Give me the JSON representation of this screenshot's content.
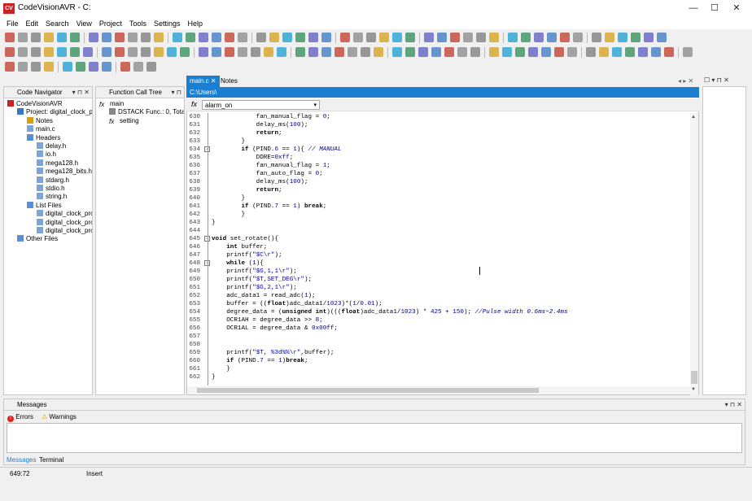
{
  "window": {
    "title": "CodeVisionAVR - C:",
    "logo": "CV"
  },
  "menu": [
    "File",
    "Edit",
    "Search",
    "View",
    "Project",
    "Tools",
    "Settings",
    "Help"
  ],
  "panels": {
    "code_navigator": "Code Navigator",
    "function_call_tree": "Function Call Tree",
    "messages": "Messages"
  },
  "nav_tree": [
    {
      "label": "CodeVisionAVR",
      "indent": 0,
      "icon": "cv-logo-icon"
    },
    {
      "label": "Project: digital_clock_pro",
      "indent": 1,
      "icon": "project-icon"
    },
    {
      "label": "Notes",
      "indent": 2,
      "icon": "notes-icon"
    },
    {
      "label": "main.c",
      "indent": 2,
      "icon": "file-icon"
    },
    {
      "label": "Headers",
      "indent": 2,
      "icon": "folder-icon"
    },
    {
      "label": "delay.h",
      "indent": 3,
      "icon": "file-icon"
    },
    {
      "label": "io.h",
      "indent": 3,
      "icon": "file-icon"
    },
    {
      "label": "mega128.h",
      "indent": 3,
      "icon": "file-icon"
    },
    {
      "label": "mega128_bits.h",
      "indent": 3,
      "icon": "file-icon"
    },
    {
      "label": "stdarg.h",
      "indent": 3,
      "icon": "file-icon"
    },
    {
      "label": "stdio.h",
      "indent": 3,
      "icon": "file-icon"
    },
    {
      "label": "string.h",
      "indent": 3,
      "icon": "file-icon"
    },
    {
      "label": "List Files",
      "indent": 2,
      "icon": "folder-icon"
    },
    {
      "label": "digital_clock_pro",
      "indent": 3,
      "icon": "file-icon"
    },
    {
      "label": "digital_clock_pro",
      "indent": 3,
      "icon": "file-icon"
    },
    {
      "label": "digital_clock_pro",
      "indent": 3,
      "icon": "file-icon"
    },
    {
      "label": "Other Files",
      "indent": 1,
      "icon": "folder-icon"
    }
  ],
  "call_tree": [
    {
      "label": "main",
      "indent": 0,
      "icon": "function-icon"
    },
    {
      "label": "DSTACK Func.: 0, Tota",
      "indent": 1,
      "icon": "stack-icon"
    },
    {
      "label": "setting",
      "indent": 1,
      "icon": "function-icon"
    }
  ],
  "tabs": [
    {
      "label": "main.c",
      "active": true
    },
    {
      "label": "Notes",
      "active": false
    }
  ],
  "path": "C:\\Users\\",
  "function_select": "alarm_on",
  "code": [
    {
      "n": "630",
      "t": "            fan_manual_flag = 0;"
    },
    {
      "n": "631",
      "t": "            delay_ms(100);"
    },
    {
      "n": "632",
      "t": "            return;"
    },
    {
      "n": "633",
      "t": "        }"
    },
    {
      "n": "634",
      "t": "        if (PIND.6 == 1){ // MANUAL",
      "fold": true
    },
    {
      "n": "635",
      "t": "            DDRE=0xff;"
    },
    {
      "n": "636",
      "t": "            fan_manual_flag = 1;"
    },
    {
      "n": "637",
      "t": "            fan_auto_flag = 0;"
    },
    {
      "n": "638",
      "t": "            delay_ms(100);"
    },
    {
      "n": "639",
      "t": "            return;"
    },
    {
      "n": "640",
      "t": "        }"
    },
    {
      "n": "641",
      "t": "        if (PIND.7 == 1) break;"
    },
    {
      "n": "642",
      "t": "        }"
    },
    {
      "n": "643",
      "t": "}"
    },
    {
      "n": "644",
      "t": ""
    },
    {
      "n": "645",
      "t": "void set_rotate(){",
      "fold": true
    },
    {
      "n": "646",
      "t": "    int buffer;"
    },
    {
      "n": "647",
      "t": "    printf(\"$C\\r\");"
    },
    {
      "n": "648",
      "t": "    while (1){",
      "fold": true
    },
    {
      "n": "649",
      "t": "    printf(\"$G,1,1\\r\");"
    },
    {
      "n": "650",
      "t": "    printf(\"$T,SET_DEG\\r\");"
    },
    {
      "n": "651",
      "t": "    printf(\"$G,2,1\\r\");"
    },
    {
      "n": "652",
      "t": "    adc_data1 = read_adc(1);"
    },
    {
      "n": "653",
      "t": "    buffer = ((float)adc_data1/1023)*(1/0.01);"
    },
    {
      "n": "654",
      "t": "    degree_data = (unsigned int)(((float)adc_data1/1023) * 425 + 150); //Pulse width 0.6ms~2.4ms"
    },
    {
      "n": "655",
      "t": "    OCR1AH = degree_data >> 8;"
    },
    {
      "n": "656",
      "t": "    OCR1AL = degree_data & 0x00ff;"
    },
    {
      "n": "657",
      "t": ""
    },
    {
      "n": "658",
      "t": ""
    },
    {
      "n": "659",
      "t": "    printf(\"$T, %3d%%\\r\",buffer);"
    },
    {
      "n": "660",
      "t": "    if (PIND.7 == 1)break;"
    },
    {
      "n": "661",
      "t": "    }"
    },
    {
      "n": "662",
      "t": "}"
    }
  ],
  "message_tabs": [
    "Errors",
    "Warnings"
  ],
  "bottom_tabs": [
    "Messages",
    "Terminal"
  ],
  "status": {
    "position": "649:72",
    "mode": "Insert"
  },
  "colors": {
    "accent": "#1a7fd1",
    "logo": "#cc2222"
  }
}
